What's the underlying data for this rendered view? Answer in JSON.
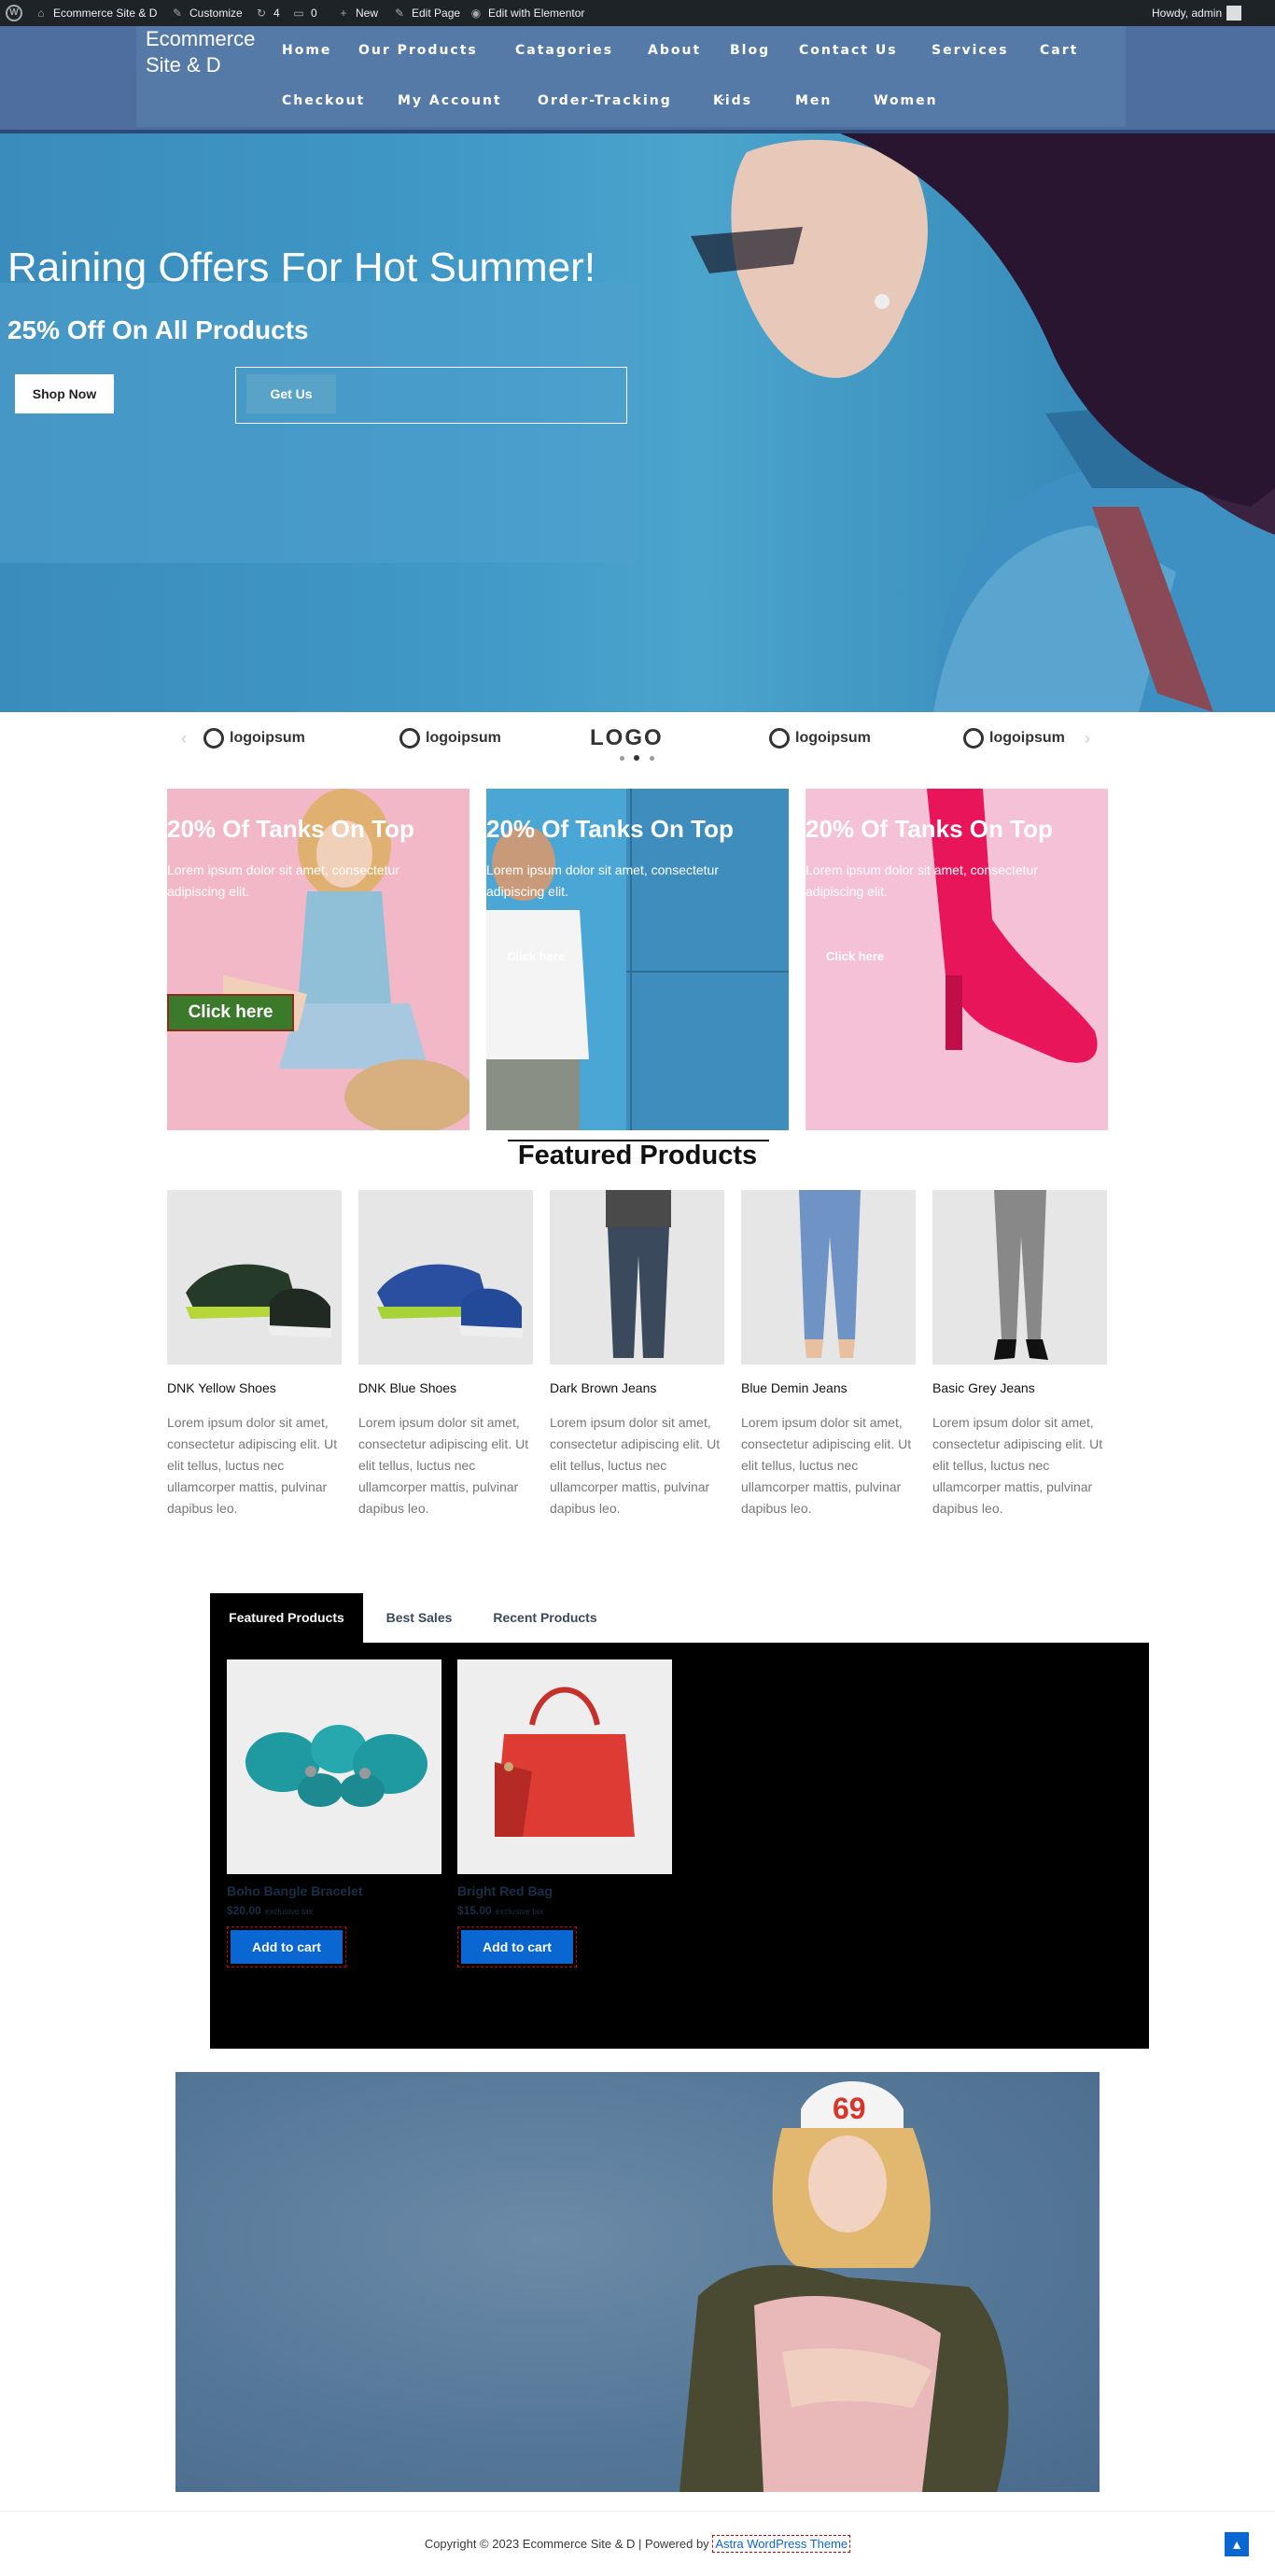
{
  "adminbar": {
    "site": "Ecommerce Site & D",
    "customize": "Customize",
    "updates": "4",
    "comments": "0",
    "new": "New",
    "edit_page": "Edit Page",
    "elementor": "Edit with Elementor",
    "howdy": "Howdy, admin"
  },
  "header": {
    "site_title": "Ecommerce Site & D",
    "nav_row1": [
      "Home",
      "Our Products",
      "Catagories",
      "About",
      "Blog",
      "Contact Us",
      "Services",
      "Cart"
    ],
    "nav_row2": [
      "Checkout",
      "My Account",
      "Order-Tracking",
      "Kids",
      "Men",
      "Women"
    ],
    "chevron": "⌄"
  },
  "hero": {
    "title": "Raining Offers For Hot Summer!",
    "subtitle": "25% Off On All Products",
    "shop_button": "Shop Now",
    "getus_button": "Get Us"
  },
  "logos": {
    "items": [
      "logoipsum",
      "logoipsum",
      "LOGO",
      "logoipsum",
      "logoipsum"
    ],
    "prev": "‹",
    "next": "›"
  },
  "promos": [
    {
      "title": "20% Of Tanks On Top",
      "text": "Lorem ipsum dolor sit amet, consectetur adipiscing elit.",
      "button": "Click here"
    },
    {
      "title": "20% Of Tanks On Top",
      "text": "Lorem ipsum dolor sit amet, consectetur adipiscing elit.",
      "button": "Click here"
    },
    {
      "title": "20% Of Tanks On Top",
      "text": "Lorem ipsum dolor sit amet, consectetur adipiscing elit.",
      "button": "Click here"
    }
  ],
  "featured": {
    "title": "Featured Products",
    "items": [
      {
        "name": "DNK Yellow Shoes",
        "desc": "Lorem ipsum dolor sit amet, consectetur adipiscing elit. Ut elit tellus, luctus nec ullamcorper mattis, pulvinar dapibus leo."
      },
      {
        "name": "DNK Blue Shoes",
        "desc": "Lorem ipsum dolor sit amet, consectetur adipiscing elit. Ut elit tellus, luctus nec ullamcorper mattis, pulvinar dapibus leo."
      },
      {
        "name": "Dark Brown Jeans",
        "desc": "Lorem ipsum dolor sit amet, consectetur adipiscing elit. Ut elit tellus, luctus nec ullamcorper mattis, pulvinar dapibus leo."
      },
      {
        "name": "Blue Demin Jeans",
        "desc": "Lorem ipsum dolor sit amet, consectetur adipiscing elit. Ut elit tellus, luctus nec ullamcorper mattis, pulvinar dapibus leo."
      },
      {
        "name": "Basic Grey Jeans",
        "desc": "Lorem ipsum dolor sit amet, consectetur adipiscing elit. Ut elit tellus, luctus nec ullamcorper mattis, pulvinar dapibus leo."
      }
    ]
  },
  "tabs": {
    "labels": [
      "Featured Products",
      "Best Sales",
      "Recent Products"
    ],
    "products": [
      {
        "name": "Boho Bangle Bracelet",
        "price": "$20.00",
        "tax": "exclusive tax",
        "button": "Add to cart"
      },
      {
        "name": "Bright Red Bag",
        "price": "$15.00",
        "tax": "exclusive tax",
        "button": "Add to cart"
      }
    ]
  },
  "footer": {
    "copyright": "Copyright © 2023 Ecommerce Site & D | Powered by",
    "theme_link": "Astra WordPress Theme",
    "scroll_top": "▲"
  },
  "colors": {
    "header": "#4f6ea0",
    "hero": "#3f98c6",
    "accent": "#0a66d0",
    "panel": "#000000"
  }
}
